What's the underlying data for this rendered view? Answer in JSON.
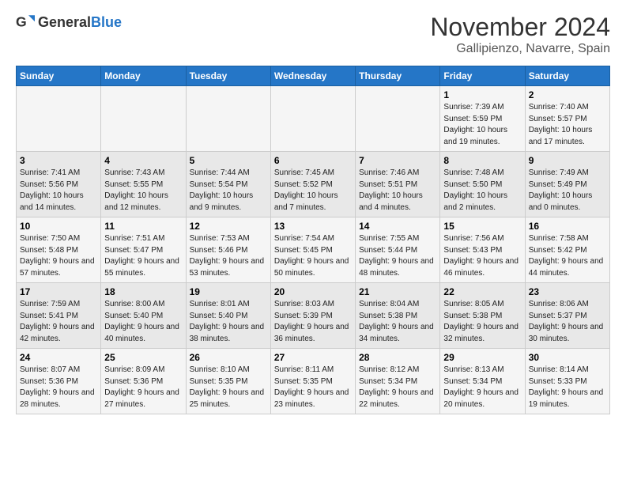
{
  "header": {
    "logo_general": "General",
    "logo_blue": "Blue",
    "title": "November 2024",
    "location": "Gallipienzo, Navarre, Spain"
  },
  "weekdays": [
    "Sunday",
    "Monday",
    "Tuesday",
    "Wednesday",
    "Thursday",
    "Friday",
    "Saturday"
  ],
  "weeks": [
    [
      {
        "day": "",
        "info": ""
      },
      {
        "day": "",
        "info": ""
      },
      {
        "day": "",
        "info": ""
      },
      {
        "day": "",
        "info": ""
      },
      {
        "day": "",
        "info": ""
      },
      {
        "day": "1",
        "info": "Sunrise: 7:39 AM\nSunset: 5:59 PM\nDaylight: 10 hours and 19 minutes."
      },
      {
        "day": "2",
        "info": "Sunrise: 7:40 AM\nSunset: 5:57 PM\nDaylight: 10 hours and 17 minutes."
      }
    ],
    [
      {
        "day": "3",
        "info": "Sunrise: 7:41 AM\nSunset: 5:56 PM\nDaylight: 10 hours and 14 minutes."
      },
      {
        "day": "4",
        "info": "Sunrise: 7:43 AM\nSunset: 5:55 PM\nDaylight: 10 hours and 12 minutes."
      },
      {
        "day": "5",
        "info": "Sunrise: 7:44 AM\nSunset: 5:54 PM\nDaylight: 10 hours and 9 minutes."
      },
      {
        "day": "6",
        "info": "Sunrise: 7:45 AM\nSunset: 5:52 PM\nDaylight: 10 hours and 7 minutes."
      },
      {
        "day": "7",
        "info": "Sunrise: 7:46 AM\nSunset: 5:51 PM\nDaylight: 10 hours and 4 minutes."
      },
      {
        "day": "8",
        "info": "Sunrise: 7:48 AM\nSunset: 5:50 PM\nDaylight: 10 hours and 2 minutes."
      },
      {
        "day": "9",
        "info": "Sunrise: 7:49 AM\nSunset: 5:49 PM\nDaylight: 10 hours and 0 minutes."
      }
    ],
    [
      {
        "day": "10",
        "info": "Sunrise: 7:50 AM\nSunset: 5:48 PM\nDaylight: 9 hours and 57 minutes."
      },
      {
        "day": "11",
        "info": "Sunrise: 7:51 AM\nSunset: 5:47 PM\nDaylight: 9 hours and 55 minutes."
      },
      {
        "day": "12",
        "info": "Sunrise: 7:53 AM\nSunset: 5:46 PM\nDaylight: 9 hours and 53 minutes."
      },
      {
        "day": "13",
        "info": "Sunrise: 7:54 AM\nSunset: 5:45 PM\nDaylight: 9 hours and 50 minutes."
      },
      {
        "day": "14",
        "info": "Sunrise: 7:55 AM\nSunset: 5:44 PM\nDaylight: 9 hours and 48 minutes."
      },
      {
        "day": "15",
        "info": "Sunrise: 7:56 AM\nSunset: 5:43 PM\nDaylight: 9 hours and 46 minutes."
      },
      {
        "day": "16",
        "info": "Sunrise: 7:58 AM\nSunset: 5:42 PM\nDaylight: 9 hours and 44 minutes."
      }
    ],
    [
      {
        "day": "17",
        "info": "Sunrise: 7:59 AM\nSunset: 5:41 PM\nDaylight: 9 hours and 42 minutes."
      },
      {
        "day": "18",
        "info": "Sunrise: 8:00 AM\nSunset: 5:40 PM\nDaylight: 9 hours and 40 minutes."
      },
      {
        "day": "19",
        "info": "Sunrise: 8:01 AM\nSunset: 5:40 PM\nDaylight: 9 hours and 38 minutes."
      },
      {
        "day": "20",
        "info": "Sunrise: 8:03 AM\nSunset: 5:39 PM\nDaylight: 9 hours and 36 minutes."
      },
      {
        "day": "21",
        "info": "Sunrise: 8:04 AM\nSunset: 5:38 PM\nDaylight: 9 hours and 34 minutes."
      },
      {
        "day": "22",
        "info": "Sunrise: 8:05 AM\nSunset: 5:38 PM\nDaylight: 9 hours and 32 minutes."
      },
      {
        "day": "23",
        "info": "Sunrise: 8:06 AM\nSunset: 5:37 PM\nDaylight: 9 hours and 30 minutes."
      }
    ],
    [
      {
        "day": "24",
        "info": "Sunrise: 8:07 AM\nSunset: 5:36 PM\nDaylight: 9 hours and 28 minutes."
      },
      {
        "day": "25",
        "info": "Sunrise: 8:09 AM\nSunset: 5:36 PM\nDaylight: 9 hours and 27 minutes."
      },
      {
        "day": "26",
        "info": "Sunrise: 8:10 AM\nSunset: 5:35 PM\nDaylight: 9 hours and 25 minutes."
      },
      {
        "day": "27",
        "info": "Sunrise: 8:11 AM\nSunset: 5:35 PM\nDaylight: 9 hours and 23 minutes."
      },
      {
        "day": "28",
        "info": "Sunrise: 8:12 AM\nSunset: 5:34 PM\nDaylight: 9 hours and 22 minutes."
      },
      {
        "day": "29",
        "info": "Sunrise: 8:13 AM\nSunset: 5:34 PM\nDaylight: 9 hours and 20 minutes."
      },
      {
        "day": "30",
        "info": "Sunrise: 8:14 AM\nSunset: 5:33 PM\nDaylight: 9 hours and 19 minutes."
      }
    ]
  ]
}
